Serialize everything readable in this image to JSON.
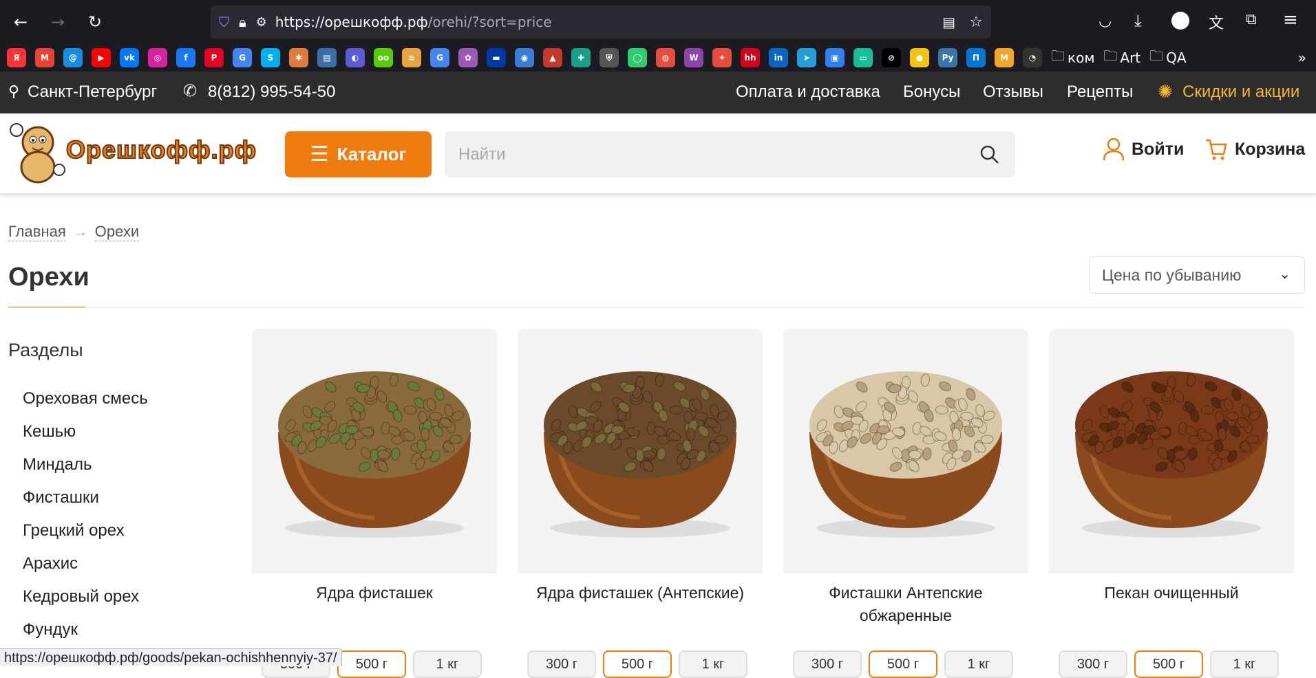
{
  "browser": {
    "url_host": "https://орешкофф.рф",
    "url_path": "/orehi/?sort=price",
    "bookmark_folders": [
      "ком",
      "Art",
      "QA"
    ],
    "bookmark_icons": [
      {
        "name": "yandex-icon",
        "color": "#f33",
        "glyph": "Я"
      },
      {
        "name": "gmail-icon",
        "color": "#ea4335",
        "glyph": "M"
      },
      {
        "name": "mail-icon",
        "color": "#168de2",
        "glyph": "@"
      },
      {
        "name": "youtube-icon",
        "color": "#ff0000",
        "glyph": "▶"
      },
      {
        "name": "vk-icon",
        "color": "#0077ff",
        "glyph": "vk"
      },
      {
        "name": "instagram-icon",
        "color": "#d6249f",
        "glyph": "◎"
      },
      {
        "name": "facebook-icon",
        "color": "#1877f2",
        "glyph": "f"
      },
      {
        "name": "pinterest-icon",
        "color": "#e60023",
        "glyph": "P"
      },
      {
        "name": "translate-icon",
        "color": "#4285f4",
        "glyph": "G"
      },
      {
        "name": "skype-icon",
        "color": "#00aff0",
        "glyph": "S"
      },
      {
        "name": "puzzle-icon",
        "color": "#e07b39",
        "glyph": "✱"
      },
      {
        "name": "news-icon",
        "color": "#3a6ea5",
        "glyph": "▤"
      },
      {
        "name": "bookmark-icon-1",
        "color": "#5b5bd6",
        "glyph": "◐"
      },
      {
        "name": "duolingo-icon",
        "color": "#58cc02",
        "glyph": "oo"
      },
      {
        "name": "bookmark-icon-2",
        "color": "#e8a33d",
        "glyph": "≡"
      },
      {
        "name": "google-icon",
        "color": "#4285f4",
        "glyph": "G"
      },
      {
        "name": "bookmark-icon-3",
        "color": "#9b59b6",
        "glyph": "✿"
      },
      {
        "name": "flag-icon",
        "color": "#0039a6",
        "glyph": "▬"
      },
      {
        "name": "bookmark-icon-4",
        "color": "#3a7bd5",
        "glyph": "◉"
      },
      {
        "name": "bookmark-icon-5",
        "color": "#c0392b",
        "glyph": "▲"
      },
      {
        "name": "bookmark-icon-6",
        "color": "#16a085",
        "glyph": "✚"
      },
      {
        "name": "bookmark-icon-7",
        "color": "#555555",
        "glyph": "⛨"
      },
      {
        "name": "bookmark-icon-8",
        "color": "#2ecc71",
        "glyph": "◯"
      },
      {
        "name": "bookmark-icon-9",
        "color": "#e74c3c",
        "glyph": "◍"
      },
      {
        "name": "bookmark-icon-10",
        "color": "#8e44ad",
        "glyph": "W"
      },
      {
        "name": "bookmark-icon-11",
        "color": "#e74c3c",
        "glyph": "✦"
      },
      {
        "name": "hh-icon",
        "color": "#d6001c",
        "glyph": "hh"
      },
      {
        "name": "linkedin-icon",
        "color": "#0a66c2",
        "glyph": "in"
      },
      {
        "name": "telegram-icon",
        "color": "#229ed9",
        "glyph": "➤"
      },
      {
        "name": "bookmark-icon-12",
        "color": "#2f80ed",
        "glyph": "▣"
      },
      {
        "name": "bookmark-icon-13",
        "color": "#1abc9c",
        "glyph": "▭"
      },
      {
        "name": "bookmark-icon-14",
        "color": "#000000",
        "glyph": "⊘"
      },
      {
        "name": "bookmark-icon-15",
        "color": "#f1c40f",
        "glyph": "●"
      },
      {
        "name": "python-icon",
        "color": "#3776ab",
        "glyph": "Py"
      },
      {
        "name": "bookmark-icon-16",
        "color": "#0078d4",
        "glyph": "П"
      },
      {
        "name": "bookmark-icon-17",
        "color": "#f5a623",
        "glyph": "M"
      },
      {
        "name": "github-icon",
        "color": "#333333",
        "glyph": "◔"
      }
    ]
  },
  "topstrip": {
    "city": "Санкт-Петербург",
    "phone": "8(812) 995-54-50",
    "links": [
      "Оплата и доставка",
      "Бонусы",
      "Отзывы",
      "Рецепты"
    ],
    "promo": "Скидки и акции"
  },
  "header": {
    "logo_text": "Орешкофф.рф",
    "catalog_label": "Каталог",
    "search_placeholder": "Найти",
    "login_label": "Войти",
    "cart_label": "Корзина"
  },
  "breadcrumb": [
    "Главная",
    "Орехи"
  ],
  "breadcrumb_sep": "→",
  "page_title": "Орехи",
  "sort_label": "Цена по убыванию",
  "sidebar": {
    "title": "Разделы",
    "items": [
      "Ореховая смесь",
      "Кешью",
      "Миндаль",
      "Фисташки",
      "Грецкий орех",
      "Арахис",
      "Кедровый орех",
      "Фундук"
    ]
  },
  "products": [
    {
      "title": "Ядра фисташек",
      "nut_color": "#8a6a3a",
      "accent": "#6b7a3a"
    },
    {
      "title": "Ядра фисташек (Антепские)",
      "nut_color": "#6a4a2a",
      "accent": "#7a6a3a"
    },
    {
      "title": "Фисташки Антепские обжаренные",
      "nut_color": "#d8c8a8",
      "accent": "#b8a07a"
    },
    {
      "title": "Пекан очищенный",
      "nut_color": "#7a3a1a",
      "accent": "#5a2a10"
    }
  ],
  "weights": [
    "300 г",
    "500 г",
    "1 кг"
  ],
  "status_url": "https://орешкофф.рф/goods/pekan-ochishhennyiy-37/",
  "colors": {
    "accent": "#f07c10",
    "dark_strip": "#2d2d2d",
    "browser_bg": "#1c1b22",
    "promo": "#f5b731"
  }
}
